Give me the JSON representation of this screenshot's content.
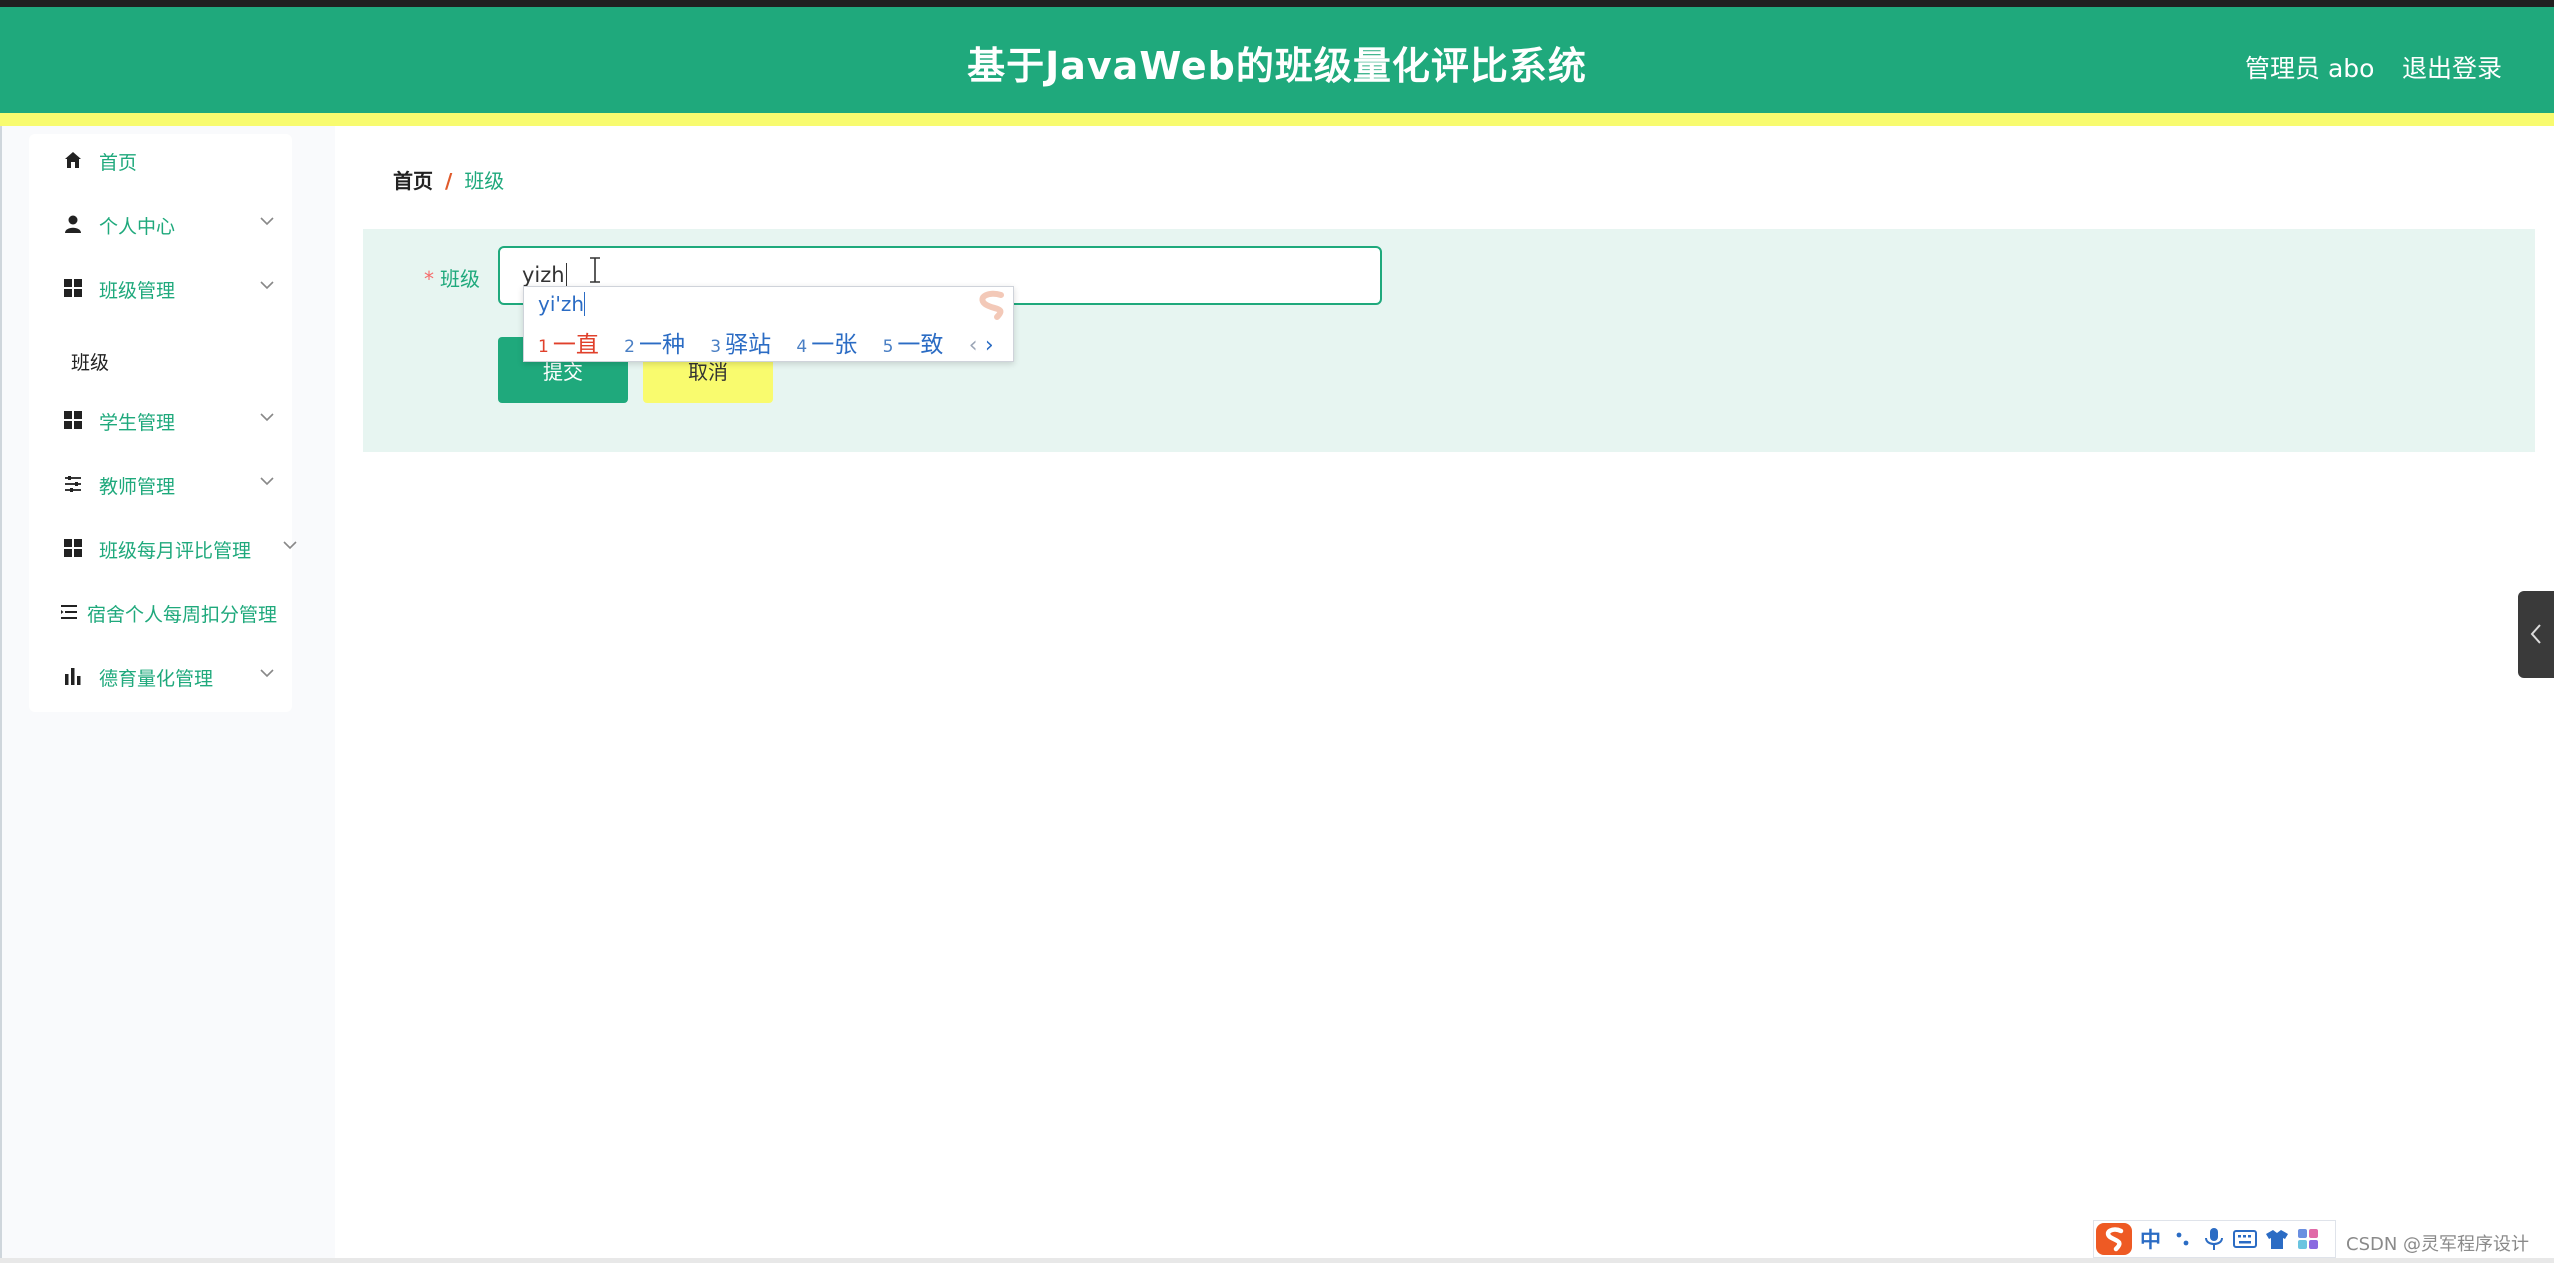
{
  "header": {
    "title": "基于JavaWeb的班级量化评比系统",
    "user": "管理员 abo",
    "logout": "退出登录"
  },
  "sidebar": {
    "items": [
      {
        "label": "首页",
        "icon": "home-icon",
        "expandable": false
      },
      {
        "label": "个人中心",
        "icon": "user-icon",
        "expandable": true
      },
      {
        "label": "班级管理",
        "icon": "grid-icon",
        "expandable": true
      },
      {
        "label": "学生管理",
        "icon": "grid-icon",
        "expandable": true
      },
      {
        "label": "教师管理",
        "icon": "sliders-icon",
        "expandable": true
      },
      {
        "label": "班级每月评比管理",
        "icon": "grid-icon",
        "expandable": true
      },
      {
        "label": "宿舍个人每周扣分管理",
        "icon": "list-icon",
        "expandable": false
      },
      {
        "label": "德育量化管理",
        "icon": "bar-chart-icon",
        "expandable": true
      }
    ],
    "submenu": {
      "label": "班级"
    }
  },
  "breadcrumb": {
    "home": "首页",
    "separator": "/",
    "current": "班级"
  },
  "form": {
    "field_label": "班级",
    "required_mark": "*",
    "input_value": "yizh",
    "submit_label": "提交",
    "cancel_label": "取消"
  },
  "ime": {
    "pinyin": "yi'zh",
    "candidates": [
      {
        "num": "1",
        "text": "一直"
      },
      {
        "num": "2",
        "text": "一种"
      },
      {
        "num": "3",
        "text": "驿站"
      },
      {
        "num": "4",
        "text": "一张"
      },
      {
        "num": "5",
        "text": "一致"
      }
    ],
    "prev": "‹",
    "next": "›",
    "toolbar_mode": "中"
  },
  "watermark": "CSDN @灵军程序设计",
  "colors": {
    "primary": "#1fa97c",
    "accent_yellow": "#f8fb6f",
    "panel_bg": "#e7f5f1"
  }
}
